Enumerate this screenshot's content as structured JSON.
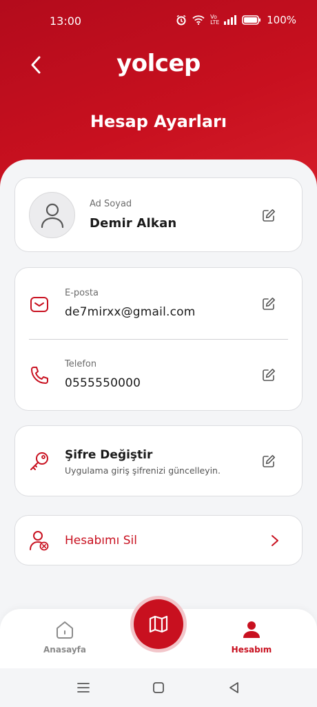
{
  "status_bar": {
    "time": "13:00",
    "battery": "100%",
    "network": "Vo LTE"
  },
  "header": {
    "logo": "yolcep",
    "title": "Hesap Ayarları"
  },
  "profile": {
    "name_label": "Ad Soyad",
    "name_value": "Demir Alkan"
  },
  "contact": {
    "email_label": "E-posta",
    "email_value": "de7mirxx@gmail.com",
    "phone_label": "Telefon",
    "phone_value": "0555550000"
  },
  "password": {
    "title": "Şifre Değiştir",
    "description": "Uygulama giriş şifrenizi güncelleyin."
  },
  "delete_account": {
    "label": "Hesabımı Sil"
  },
  "bottom_nav": {
    "home_label": "Anasayfa",
    "account_label": "Hesabım"
  },
  "colors": {
    "primary": "#c8101f",
    "background": "#f4f5f7",
    "card_border": "#dcdde0"
  },
  "icons": [
    "back-arrow-icon",
    "user-icon",
    "edit-icon",
    "mail-icon",
    "phone-icon",
    "key-icon",
    "user-delete-icon",
    "chevron-right-icon",
    "home-icon",
    "map-icon",
    "account-icon"
  ]
}
